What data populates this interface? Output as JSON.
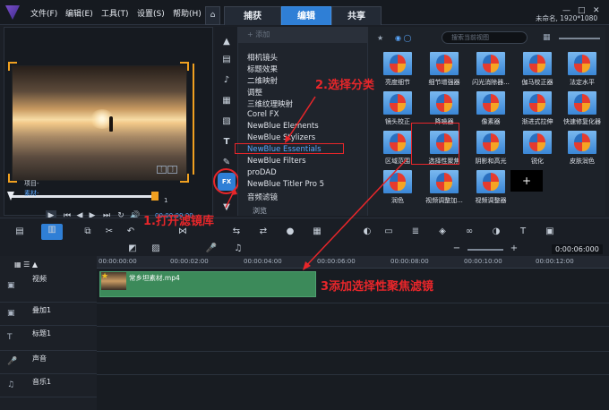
{
  "menu": {
    "file": "文件(F)",
    "edit": "编辑(E)",
    "tools": "工具(T)",
    "settings": "设置(S)",
    "help": "帮助(H)"
  },
  "tabs": [
    {
      "label": "捕获"
    },
    {
      "label": "编辑"
    },
    {
      "label": "共享"
    }
  ],
  "window_controls": {
    "minimize": "—",
    "maximize": "□",
    "close": "✕"
  },
  "project_info": "未命名, 1920*1080",
  "preview": {
    "project_label": "项目-",
    "clip_label": "素材-",
    "timecode": "00:00:00:00",
    "zoom": "1"
  },
  "library": {
    "add_label": "+ 添加",
    "browse_label": "浏览"
  },
  "categories": [
    "相机镜头",
    "标题效果",
    "二维映射",
    "调整",
    "三维纹理映射",
    "Corel FX",
    "NewBlue Elements",
    "NewBlue Stylizers",
    "NewBlue Essentials",
    "NewBlue Filters",
    "proDAD",
    "NewBlue Titler Pro 5",
    "音频滤镜"
  ],
  "selected_category": "NewBlue Essentials",
  "search_placeholder": "搜索当前视图",
  "filters": [
    [
      "亮度细节",
      "细节增强器",
      "闪光消除器...",
      "伽马校正器",
      "法定水平"
    ],
    [
      "镜头校正",
      "降噪器",
      "像素器",
      "渐进式拉伸",
      "快速修复化器"
    ],
    [
      "区域范围",
      "选择性聚焦",
      "阴影和高光",
      "锐化",
      "皮肤润色"
    ],
    [
      "润色",
      "视频调整加...",
      "视频调整器",
      ""
    ]
  ],
  "ruler_ticks": [
    "00:00:00:00",
    "00:00:02:00",
    "00:00:04:00",
    "00:00:06:00",
    "00:00:08:00",
    "00:00:10:00",
    "00:00:12:00"
  ],
  "timeline_timecode": "0:00:06:000",
  "tracks": [
    {
      "name": "视频"
    },
    {
      "name": "叠加1"
    },
    {
      "name": "标题1"
    },
    {
      "name": "声音"
    },
    {
      "name": "音乐1"
    }
  ],
  "clip_name": "常乡坦素材.mp4",
  "annotations": {
    "step1": "1.打开滤镜库",
    "step2": "2.选择分类",
    "step3": "3添加选择性聚焦滤镜"
  },
  "icons": {
    "fx": "FX",
    "title_tool": "T"
  }
}
